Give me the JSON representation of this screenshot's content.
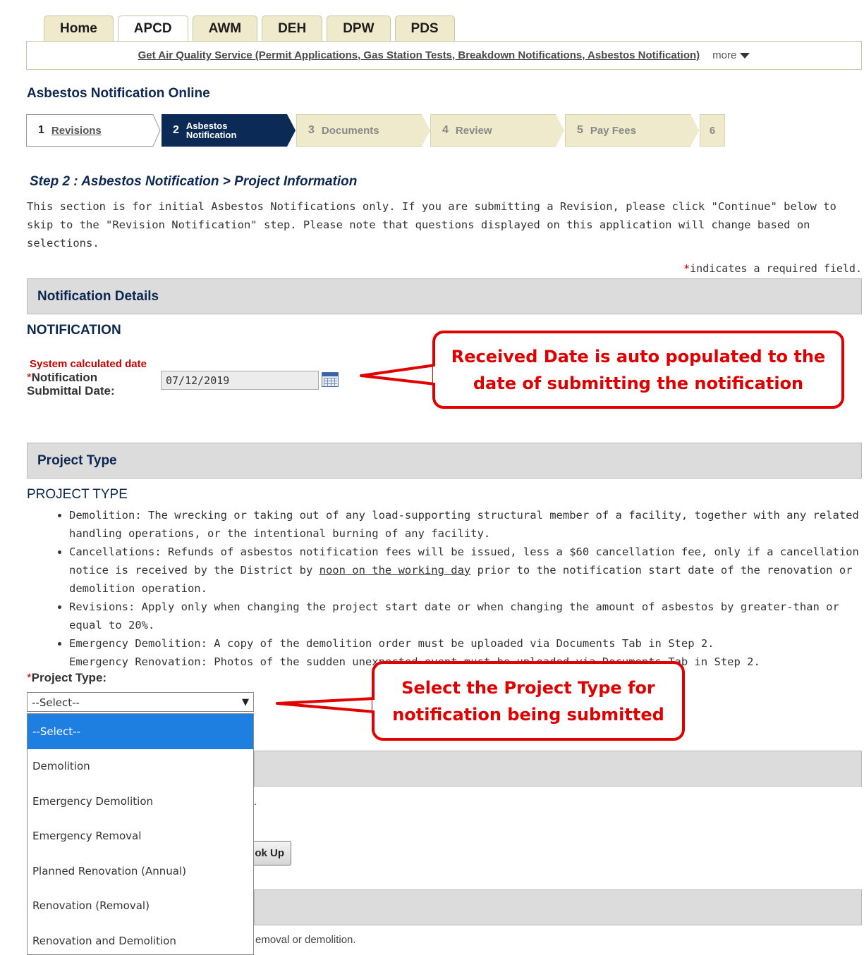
{
  "tabs": [
    {
      "label": "Home",
      "active": false
    },
    {
      "label": "APCD",
      "active": true
    },
    {
      "label": "AWM",
      "active": false
    },
    {
      "label": "DEH",
      "active": false
    },
    {
      "label": "DPW",
      "active": false
    },
    {
      "label": "PDS",
      "active": false
    }
  ],
  "tab_bar": {
    "link": "Get Air Quality Service (Permit Applications, Gas Station Tests, Breakdown Notifications, Asbestos Notification)",
    "more": "more"
  },
  "page_title": "Asbestos Notification Online",
  "steps": [
    {
      "num": "1",
      "label": "Revisions"
    },
    {
      "num": "2",
      "label_line1": "Asbestos",
      "label_line2": "Notification"
    },
    {
      "num": "3",
      "label": "Documents"
    },
    {
      "num": "4",
      "label": "Review"
    },
    {
      "num": "5",
      "label": "Pay Fees"
    },
    {
      "num": "6"
    }
  ],
  "step_heading": "Step 2 : Asbestos Notification > Project Information",
  "intro_text": "This section is for initial Asbestos Notifications only.  If you are submitting a Revision, please click \"Continue\" below to skip to the \"Revision Notification\" step.  Please note that questions displayed on this application will change based on selections.",
  "required_note": {
    "star": "*",
    "text": "indicates a required field."
  },
  "notification_details": {
    "section_title": "Notification Details",
    "sub_heading": "NOTIFICATION",
    "system_note": "System calculated date",
    "field_star": "*",
    "field_label": "Notification Submittal Date:",
    "field_value": "07/12/2019"
  },
  "callouts": {
    "received_date": "Received Date is auto populated to the date of submitting the notification",
    "project_type": "Select the Project Type for notification being submitted"
  },
  "project_type": {
    "section_title": "Project Type",
    "sub_heading": "PROJECT TYPE",
    "bullets": {
      "demolition": "Demolition: The wrecking or taking out of any load-supporting structural member of a facility, together with any related handling operations, or the intentional burning of any facility.",
      "cancellations_a": "Cancellations: Refunds of asbestos notification fees will be issued, less a $60 cancellation fee, only if a cancellation notice is received by the District by ",
      "cancellations_u": "noon on the working day",
      "cancellations_b": " prior to the notification start date of the renovation or demolition operation.",
      "revisions": "Revisions: Apply only when changing the project start date or when changing the amount of asbestos by greater-than or equal to 20%.",
      "emergency_demo": "Emergency Demolition: A copy of the demolition order must be uploaded via Documents Tab in Step 2.",
      "emergency_reno": "Emergency Renovation: Photos of the sudden unexpected event must be uploaded via Documents Tab in Step 2."
    },
    "field_star": "*",
    "field_label": "Project Type:",
    "selected": "--Select--",
    "options": [
      "--Select--",
      "Demolition",
      "Emergency Demolition",
      "Emergency Removal",
      "Planned Renovation (Annual)",
      "Renovation (Removal)",
      "Renovation and Demolition"
    ]
  },
  "obscured": {
    "fragment1": ".",
    "lookup_button": "ok Up",
    "fragment2": "emoval or demolition."
  }
}
